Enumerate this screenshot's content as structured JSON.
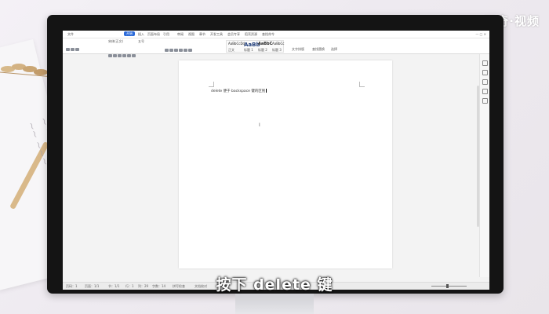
{
  "watermark": "天奇·视频",
  "subtitle": "按下 delete 键",
  "app": {
    "titlebar": {
      "menu_items": [
        "文件",
        "开始",
        "插入",
        "页面布局",
        "引用",
        "审阅",
        "视图",
        "章节",
        "开发工具",
        "会员专享",
        "稻壳资源",
        "查找命令"
      ],
      "active_tab": "开始"
    },
    "ribbon": {
      "font_name": "宋体(正文)",
      "font_size": "五号",
      "style_samples": [
        "AaBbCcDd",
        "AaBb",
        "AaBbC",
        "AaBbCc"
      ],
      "style_labels": [
        "正文",
        "标题 1",
        "标题 2",
        "标题 3"
      ],
      "groups": [
        "文字排版",
        "查找替换",
        "选择"
      ]
    },
    "document": {
      "text": "delete 便于 backspace 键的区别"
    },
    "statusbar": {
      "items": [
        "页码：1",
        "页面：1/1",
        "节：1/1",
        "行：1",
        "列：29",
        "字数：14",
        "拼写检查",
        "文档校对"
      ]
    }
  }
}
